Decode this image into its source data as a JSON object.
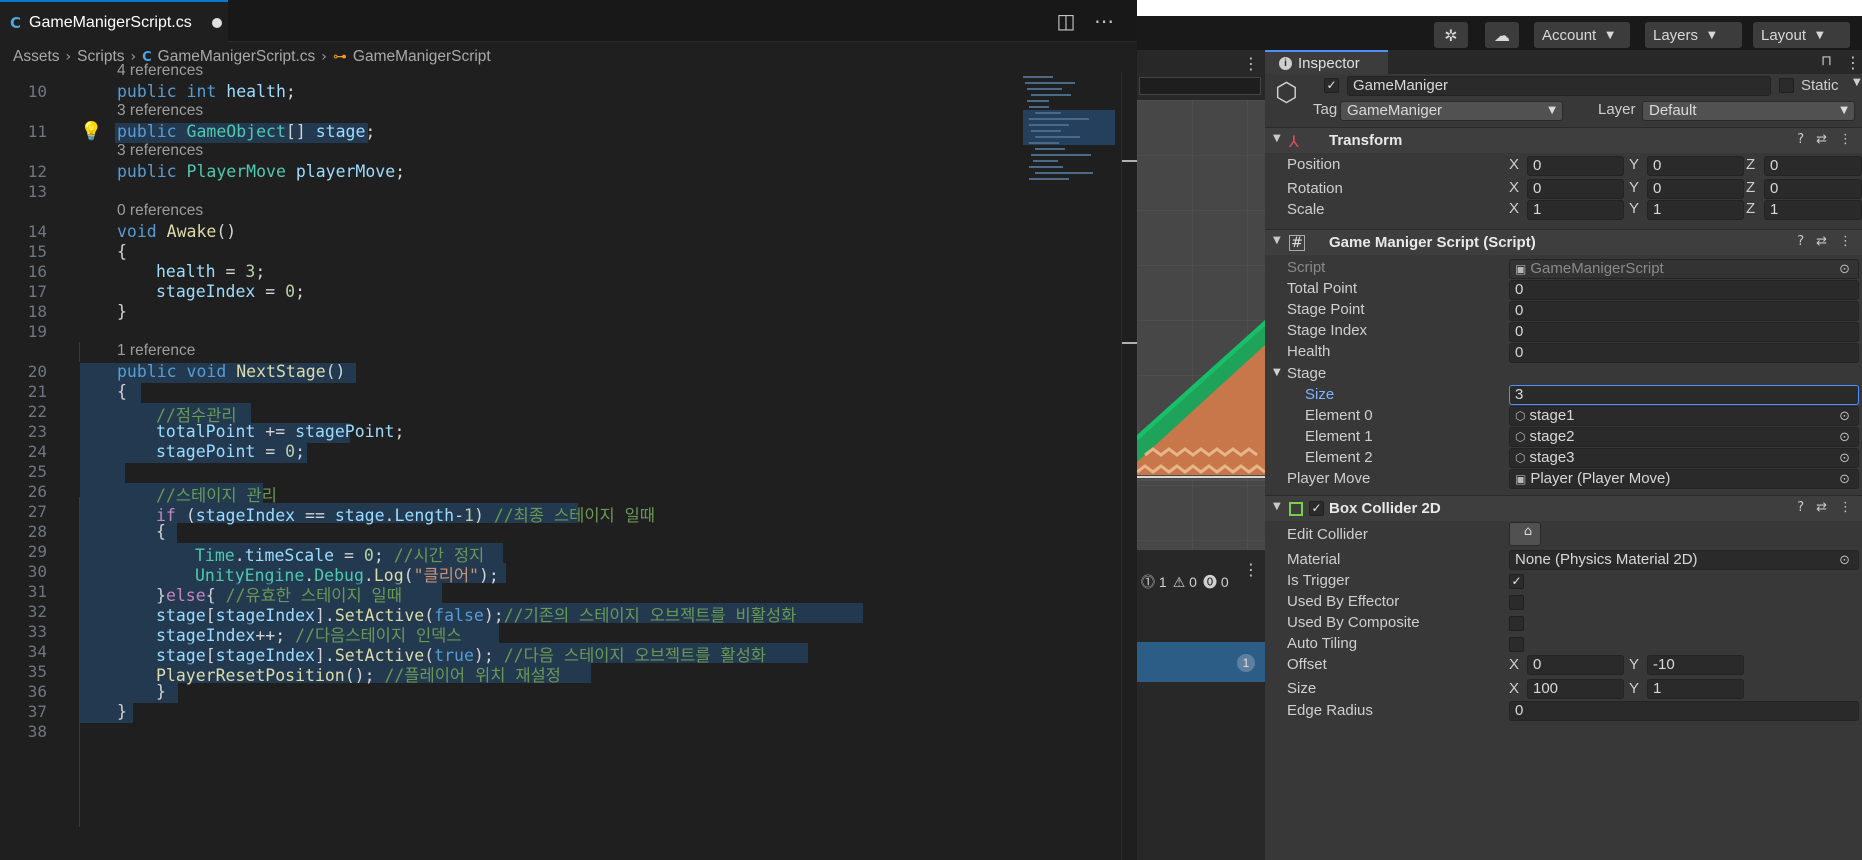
{
  "editor": {
    "tab_title": "GameManigerScript.cs",
    "breadcrumb": [
      "Assets",
      "Scripts",
      "GameManigerScript.cs",
      "GameManigerScript"
    ],
    "code_lines": [
      {
        "n": "10",
        "ref": "4 references",
        "tokens": [
          [
            "kw",
            "public "
          ],
          [
            "kw",
            "int "
          ],
          [
            "var",
            "health"
          ],
          [
            "",
            "; "
          ]
        ]
      },
      {
        "n": "11",
        "ref": "3 references",
        "tokens": [
          [
            "kw",
            "public "
          ],
          [
            "ty",
            "GameObject"
          ],
          [
            "",
            "[] "
          ],
          [
            "var",
            "stage"
          ],
          [
            "",
            ";"
          ]
        ]
      },
      {
        "n": "12",
        "ref": "3 references",
        "tokens": [
          [
            "kw",
            "public "
          ],
          [
            "ty",
            "PlayerMove "
          ],
          [
            "var",
            "playerMove"
          ],
          [
            "",
            ";"
          ]
        ]
      },
      {
        "n": "13",
        "ref": "",
        "tokens": []
      },
      {
        "n": "14",
        "ref": "0 references",
        "tokens": [
          [
            "kw",
            "void "
          ],
          [
            "fn",
            "Awake"
          ],
          [
            "",
            "()"
          ]
        ]
      },
      {
        "n": "15",
        "ref": "",
        "tokens": [
          [
            "",
            "{"
          ]
        ]
      },
      {
        "n": "16",
        "ref": "",
        "tokens": [
          [
            "var",
            "health"
          ],
          [
            "",
            " = "
          ],
          [
            "num",
            "3"
          ],
          [
            "",
            ";"
          ]
        ]
      },
      {
        "n": "17",
        "ref": "",
        "tokens": [
          [
            "var",
            "stageIndex"
          ],
          [
            "",
            " = "
          ],
          [
            "num",
            "0"
          ],
          [
            "",
            ";"
          ]
        ]
      },
      {
        "n": "18",
        "ref": "",
        "tokens": [
          [
            "",
            "}"
          ]
        ]
      },
      {
        "n": "19",
        "ref": "",
        "tokens": []
      },
      {
        "n": "20",
        "ref": "1 reference",
        "tokens": [
          [
            "kw",
            "public "
          ],
          [
            "kw",
            "void "
          ],
          [
            "fn",
            "NextStage"
          ],
          [
            "",
            "()"
          ]
        ]
      },
      {
        "n": "21",
        "ref": "",
        "tokens": [
          [
            "",
            "{"
          ]
        ]
      },
      {
        "n": "22",
        "ref": "",
        "tokens": [
          [
            "cm",
            "//점수관리"
          ]
        ]
      },
      {
        "n": "23",
        "ref": "",
        "tokens": [
          [
            "var",
            "totalPoint"
          ],
          [
            "",
            " += "
          ],
          [
            "var",
            "stagePoint"
          ],
          [
            "",
            ";"
          ]
        ]
      },
      {
        "n": "24",
        "ref": "",
        "tokens": [
          [
            "var",
            "stagePoint"
          ],
          [
            "",
            " = "
          ],
          [
            "num",
            "0"
          ],
          [
            "",
            ";"
          ]
        ]
      },
      {
        "n": "25",
        "ref": "",
        "tokens": []
      },
      {
        "n": "26",
        "ref": "",
        "tokens": [
          [
            "cm",
            "//스테이지 관리"
          ]
        ]
      },
      {
        "n": "27",
        "ref": "",
        "tokens": [
          [
            "ctl",
            "if "
          ],
          [
            "",
            "("
          ],
          [
            "var",
            "stageIndex"
          ],
          [
            "",
            " == "
          ],
          [
            "var",
            "stage"
          ],
          [
            "",
            "."
          ],
          [
            "var",
            "Length"
          ],
          [
            "",
            "-"
          ],
          [
            "num",
            "1"
          ],
          [
            "",
            ") "
          ],
          [
            "cm",
            "//최종 스테이지 일때"
          ]
        ]
      },
      {
        "n": "28",
        "ref": "",
        "tokens": [
          [
            "",
            "{"
          ]
        ]
      },
      {
        "n": "29",
        "ref": "",
        "tokens": [
          [
            "ty",
            "Time"
          ],
          [
            "",
            "."
          ],
          [
            "var",
            "timeScale"
          ],
          [
            "",
            " = "
          ],
          [
            "num",
            "0"
          ],
          [
            "",
            "; "
          ],
          [
            "cm",
            "//시간 정지"
          ]
        ]
      },
      {
        "n": "30",
        "ref": "",
        "tokens": [
          [
            "ty",
            "UnityEngine"
          ],
          [
            "",
            "."
          ],
          [
            "ty",
            "Debug"
          ],
          [
            "",
            "."
          ],
          [
            "fn",
            "Log"
          ],
          [
            "",
            "("
          ],
          [
            "str",
            "\"클리어\""
          ],
          [
            "",
            ");"
          ]
        ]
      },
      {
        "n": "31",
        "ref": "",
        "tokens": [
          [
            "",
            "}"
          ],
          [
            "ctl",
            "else"
          ],
          [
            "",
            "{ "
          ],
          [
            "cm",
            "//유효한 스테이지 일때"
          ]
        ]
      },
      {
        "n": "32",
        "ref": "",
        "tokens": [
          [
            "var",
            "stage"
          ],
          [
            "",
            "["
          ],
          [
            "var",
            "stageIndex"
          ],
          [
            "",
            "]."
          ],
          [
            "fn",
            "SetActive"
          ],
          [
            "",
            "("
          ],
          [
            "kw",
            "false"
          ],
          [
            "",
            ");"
          ],
          [
            "cm",
            "//기존의 스테이지 오브젝트를 비활성화  "
          ]
        ]
      },
      {
        "n": "33",
        "ref": "",
        "tokens": [
          [
            "var",
            "stageIndex"
          ],
          [
            "",
            "++; "
          ],
          [
            "cm",
            "//다음스테이지 인덱스"
          ]
        ]
      },
      {
        "n": "34",
        "ref": "",
        "tokens": [
          [
            "var",
            "stage"
          ],
          [
            "",
            "["
          ],
          [
            "var",
            "stageIndex"
          ],
          [
            "",
            "]."
          ],
          [
            "fn",
            "SetActive"
          ],
          [
            "",
            "("
          ],
          [
            "kw",
            "true"
          ],
          [
            "",
            "); "
          ],
          [
            "cm",
            "//다음 스테이지 오브젝트를 활성화"
          ]
        ]
      },
      {
        "n": "35",
        "ref": "",
        "tokens": [
          [
            "fn",
            "PlayerResetPosition"
          ],
          [
            "",
            "(); "
          ],
          [
            "cm",
            "//플레이어 위치 재설정"
          ]
        ]
      },
      {
        "n": "36",
        "ref": "",
        "tokens": [
          [
            "",
            "}"
          ]
        ]
      },
      {
        "n": "37",
        "ref": "",
        "tokens": [
          [
            "",
            "}"
          ]
        ]
      },
      {
        "n": "38",
        "ref": "",
        "tokens": []
      }
    ]
  },
  "unity_toolbar": {
    "account": "Account",
    "layers": "Layers",
    "layout": "Layout"
  },
  "console": {
    "errors": "1",
    "warnings": "0",
    "messages": "0",
    "selected_count": "1"
  },
  "inspector": {
    "tab": "Inspector",
    "object_name": "GameManiger",
    "static_label": "Static",
    "tag_label": "Tag",
    "tag_value": "GameManiger",
    "layer_label": "Layer",
    "layer_value": "Default",
    "transform": {
      "title": "Transform",
      "position": {
        "label": "Position",
        "x": "0",
        "y": "0",
        "z": "0"
      },
      "rotation": {
        "label": "Rotation",
        "x": "0",
        "y": "0",
        "z": "0"
      },
      "scale": {
        "label": "Scale",
        "x": "1",
        "y": "1",
        "z": "1"
      }
    },
    "script_comp": {
      "title": "Game Maniger Script (Script)",
      "script_label": "Script",
      "script_value": "GameManigerScript",
      "total_point_label": "Total Point",
      "total_point": "0",
      "stage_point_label": "Stage Point",
      "stage_point": "0",
      "stage_index_label": "Stage Index",
      "stage_index": "0",
      "health_label": "Health",
      "health": "0",
      "stage_label": "Stage",
      "size_label": "Size",
      "size": "3",
      "elements": [
        {
          "label": "Element 0",
          "value": "stage1"
        },
        {
          "label": "Element 1",
          "value": "stage2"
        },
        {
          "label": "Element 2",
          "value": "stage3"
        }
      ],
      "player_move_label": "Player Move",
      "player_move": "Player (Player Move)"
    },
    "box_collider": {
      "title": "Box Collider 2D",
      "edit_collider_label": "Edit Collider",
      "material_label": "Material",
      "material": "None (Physics Material 2D)",
      "is_trigger_label": "Is Trigger",
      "is_trigger": true,
      "used_by_effector_label": "Used By Effector",
      "used_by_effector": false,
      "used_by_composite_label": "Used By Composite",
      "used_by_composite": false,
      "auto_tiling_label": "Auto Tiling",
      "auto_tiling": false,
      "offset_label": "Offset",
      "offset_x": "0",
      "offset_y": "-10",
      "size_label": "Size",
      "size_x": "100",
      "size_y": "1",
      "edge_radius_label": "Edge Radius",
      "edge_radius": "0"
    }
  },
  "colors": {
    "editor_bg": "#1f1f1f",
    "selection": "#264f78",
    "inspector_bg": "#383838",
    "accent": "#4d90fe"
  }
}
